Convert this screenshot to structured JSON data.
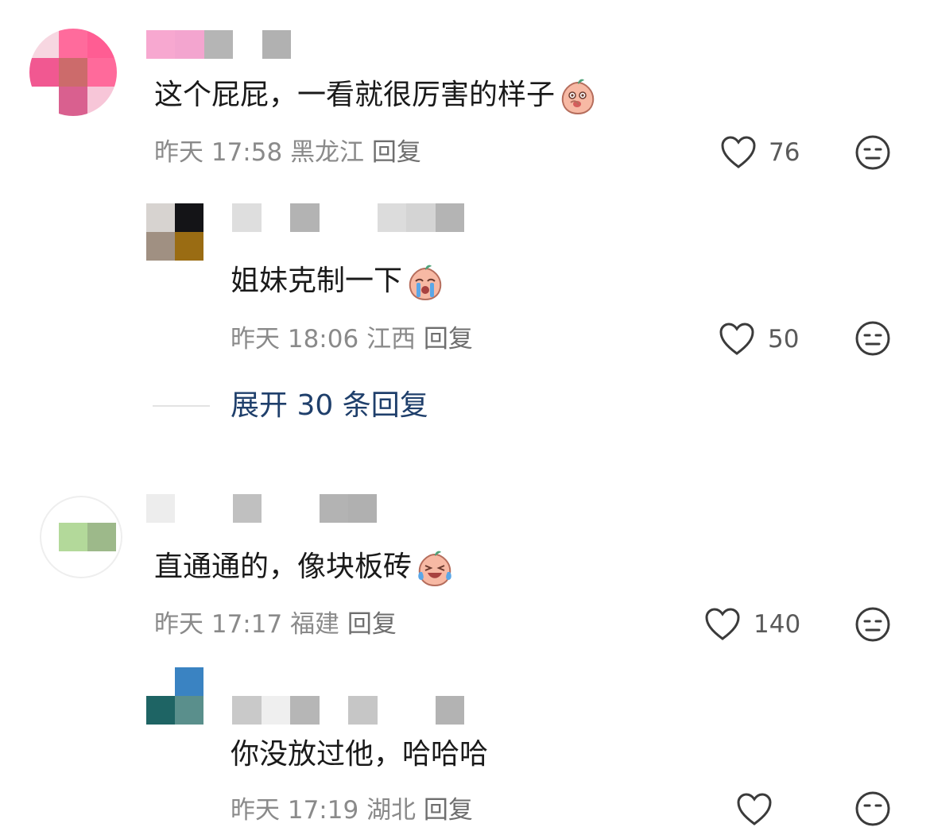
{
  "comments": [
    {
      "text": "这个屁屁，一看就很厉害的样子",
      "emoji": "peach-shy-emoji",
      "time": "昨天 17:58",
      "location": "黑龙江",
      "reply_label": "回复",
      "likes": "76",
      "replies": [
        {
          "text": "姐妹克制一下",
          "emoji": "peach-crying-emoji",
          "time": "昨天 18:06",
          "location": "江西",
          "reply_label": "回复",
          "likes": "50"
        }
      ],
      "expand_label": "展开 30 条回复"
    },
    {
      "text": "直通通的，像块板砖",
      "emoji": "peach-laugh-cry-emoji",
      "time": "昨天 17:17",
      "location": "福建",
      "reply_label": "回复",
      "likes": "140",
      "replies": [
        {
          "text": "你没放过他，哈哈哈",
          "time": "昨天 17:19",
          "location": "湖北",
          "reply_label": "回复"
        }
      ]
    }
  ],
  "colors": {
    "link_blue": "#1f3f6b",
    "meta_gray": "#8a8a8a",
    "text_dark": "#1a1a1a"
  }
}
